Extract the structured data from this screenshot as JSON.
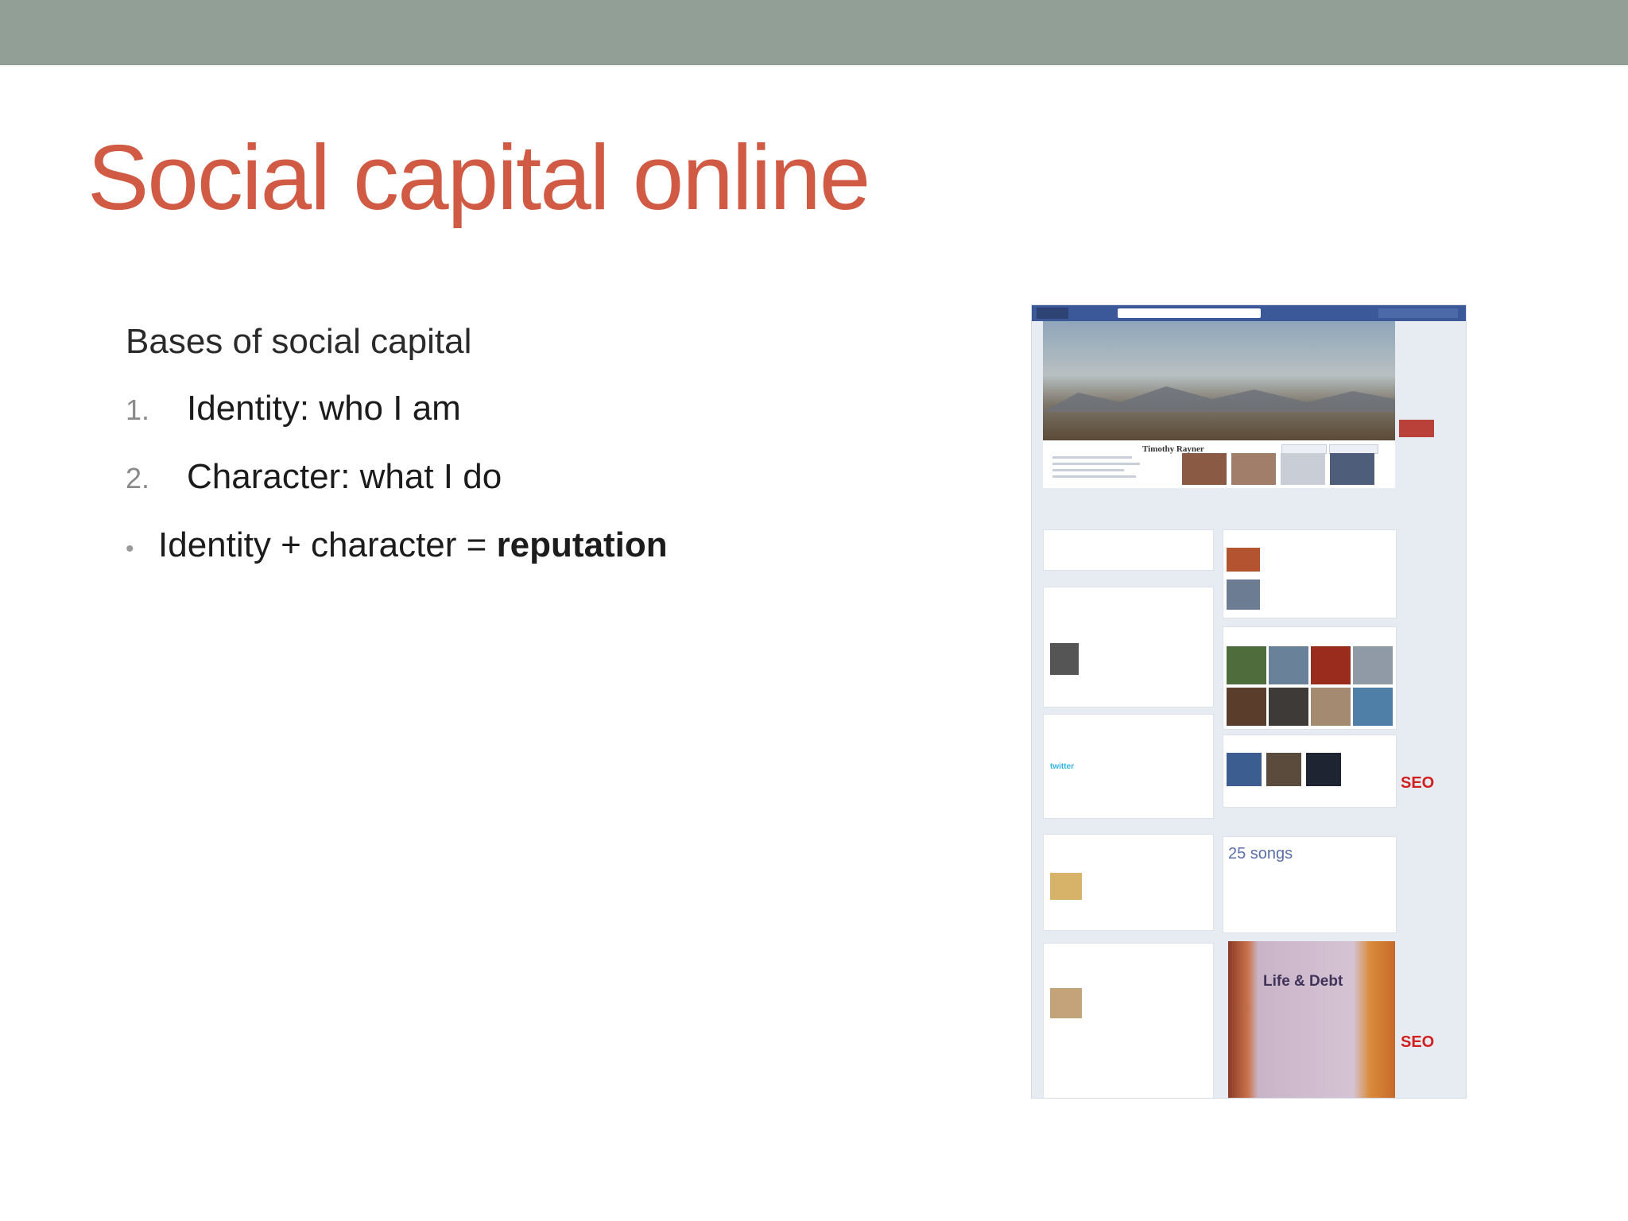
{
  "slide": {
    "title": "Social capital online",
    "heading": "Bases of social capital",
    "items": [
      {
        "num": "1.",
        "text": "Identity: who I am"
      },
      {
        "num": "2.",
        "text": "Character: what I do"
      }
    ],
    "bullet_marker": "•",
    "bullet_plain": "Identity + character = ",
    "bullet_bold": "reputation"
  },
  "screenshot": {
    "profile_name": "Timothy Rayner",
    "songs": "25 songs",
    "ad_badge": "SEO",
    "ad_badge_2": "SEO",
    "brand": "twitter",
    "book": "Life & Debt"
  },
  "colors": {
    "top_bar": "#929f96",
    "title": "#d05a43",
    "facebook_blue": "#3b5998"
  }
}
